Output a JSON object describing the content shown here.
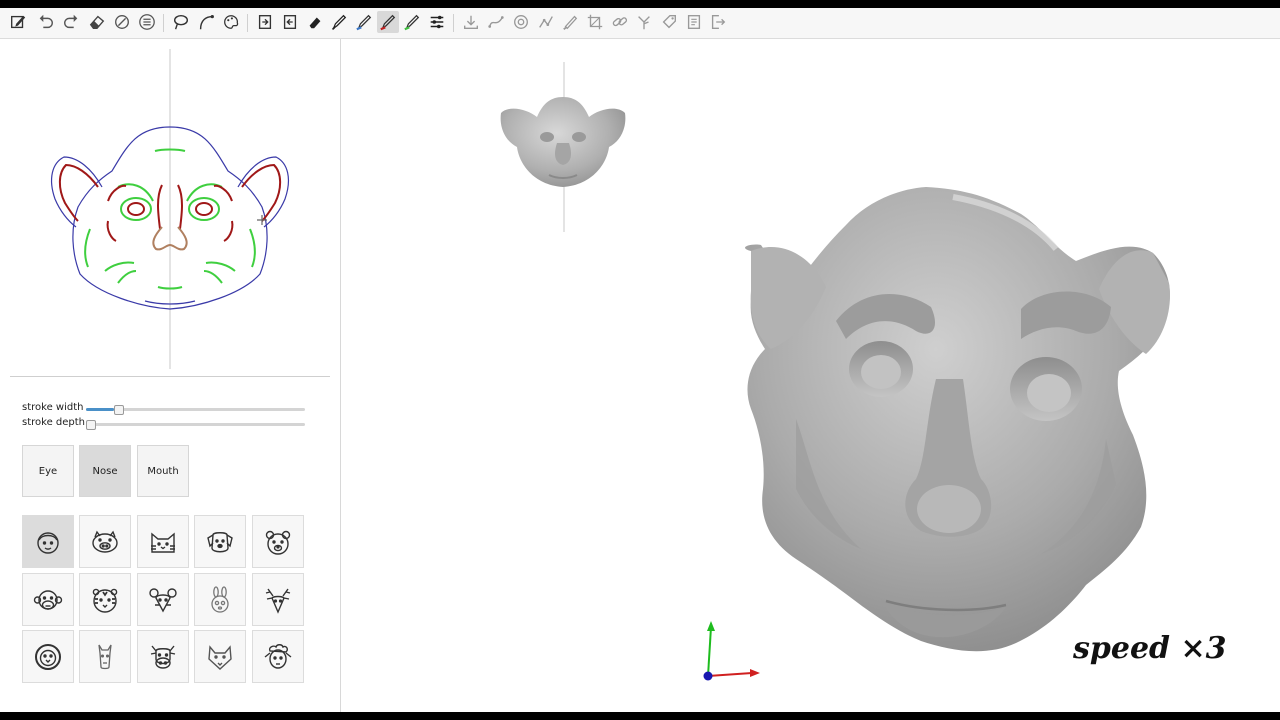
{
  "toolbar": {
    "tools": [
      {
        "icon": "edit-icon"
      },
      {
        "icon": "undo-icon"
      },
      {
        "icon": "redo-icon"
      },
      {
        "icon": "eraser-icon"
      },
      {
        "icon": "clear-icon"
      },
      {
        "icon": "list-icon"
      },
      {
        "icon": "lasso-icon"
      },
      {
        "icon": "curve-icon"
      },
      {
        "icon": "palette-icon"
      },
      {
        "icon": "import-icon"
      },
      {
        "icon": "export-icon"
      },
      {
        "icon": "eraser-tool-icon"
      },
      {
        "icon": "pen-black-icon"
      },
      {
        "icon": "pen-blue-icon"
      },
      {
        "icon": "pen-red-icon"
      },
      {
        "icon": "pen-green-icon"
      },
      {
        "icon": "settings-sliders-icon"
      },
      {
        "icon": "download-icon"
      },
      {
        "icon": "path-icon"
      },
      {
        "icon": "target-icon"
      },
      {
        "icon": "graph-icon"
      },
      {
        "icon": "brush-icon"
      },
      {
        "icon": "crop-icon"
      },
      {
        "icon": "link-icon"
      },
      {
        "icon": "branch-icon"
      },
      {
        "icon": "tag-icon"
      },
      {
        "icon": "document-icon"
      },
      {
        "icon": "logout-icon"
      }
    ]
  },
  "sliders": {
    "stroke_width": {
      "label": "stroke width",
      "value": 0.13
    },
    "stroke_depth": {
      "label": "stroke depth",
      "value": 0.0
    }
  },
  "parts": {
    "eye": "Eye",
    "nose": "Nose",
    "mouth": "Mouth",
    "active": "Nose"
  },
  "animals": [
    {
      "icon": "human-face-icon",
      "active": true
    },
    {
      "icon": "pig-face-icon"
    },
    {
      "icon": "cat-face-icon"
    },
    {
      "icon": "dog-face-icon"
    },
    {
      "icon": "bear-face-icon"
    },
    {
      "icon": "monkey-face-icon"
    },
    {
      "icon": "tiger-face-icon"
    },
    {
      "icon": "mouse-face-icon"
    },
    {
      "icon": "rabbit-face-icon"
    },
    {
      "icon": "deer-face-icon"
    },
    {
      "icon": "lion-face-icon"
    },
    {
      "icon": "llama-face-icon"
    },
    {
      "icon": "cow-face-icon"
    },
    {
      "icon": "wolf-face-icon"
    },
    {
      "icon": "sheep-face-icon"
    }
  ],
  "overlay": {
    "speed": "speed ×3"
  },
  "colors": {
    "stroke_blue": "#3a3aa8",
    "stroke_red": "#a01818",
    "stroke_green": "#3fcf3f",
    "stroke_brown": "#b08060",
    "mesh_gray": "#a8a8a8",
    "slider_accent": "#4a90c8"
  }
}
